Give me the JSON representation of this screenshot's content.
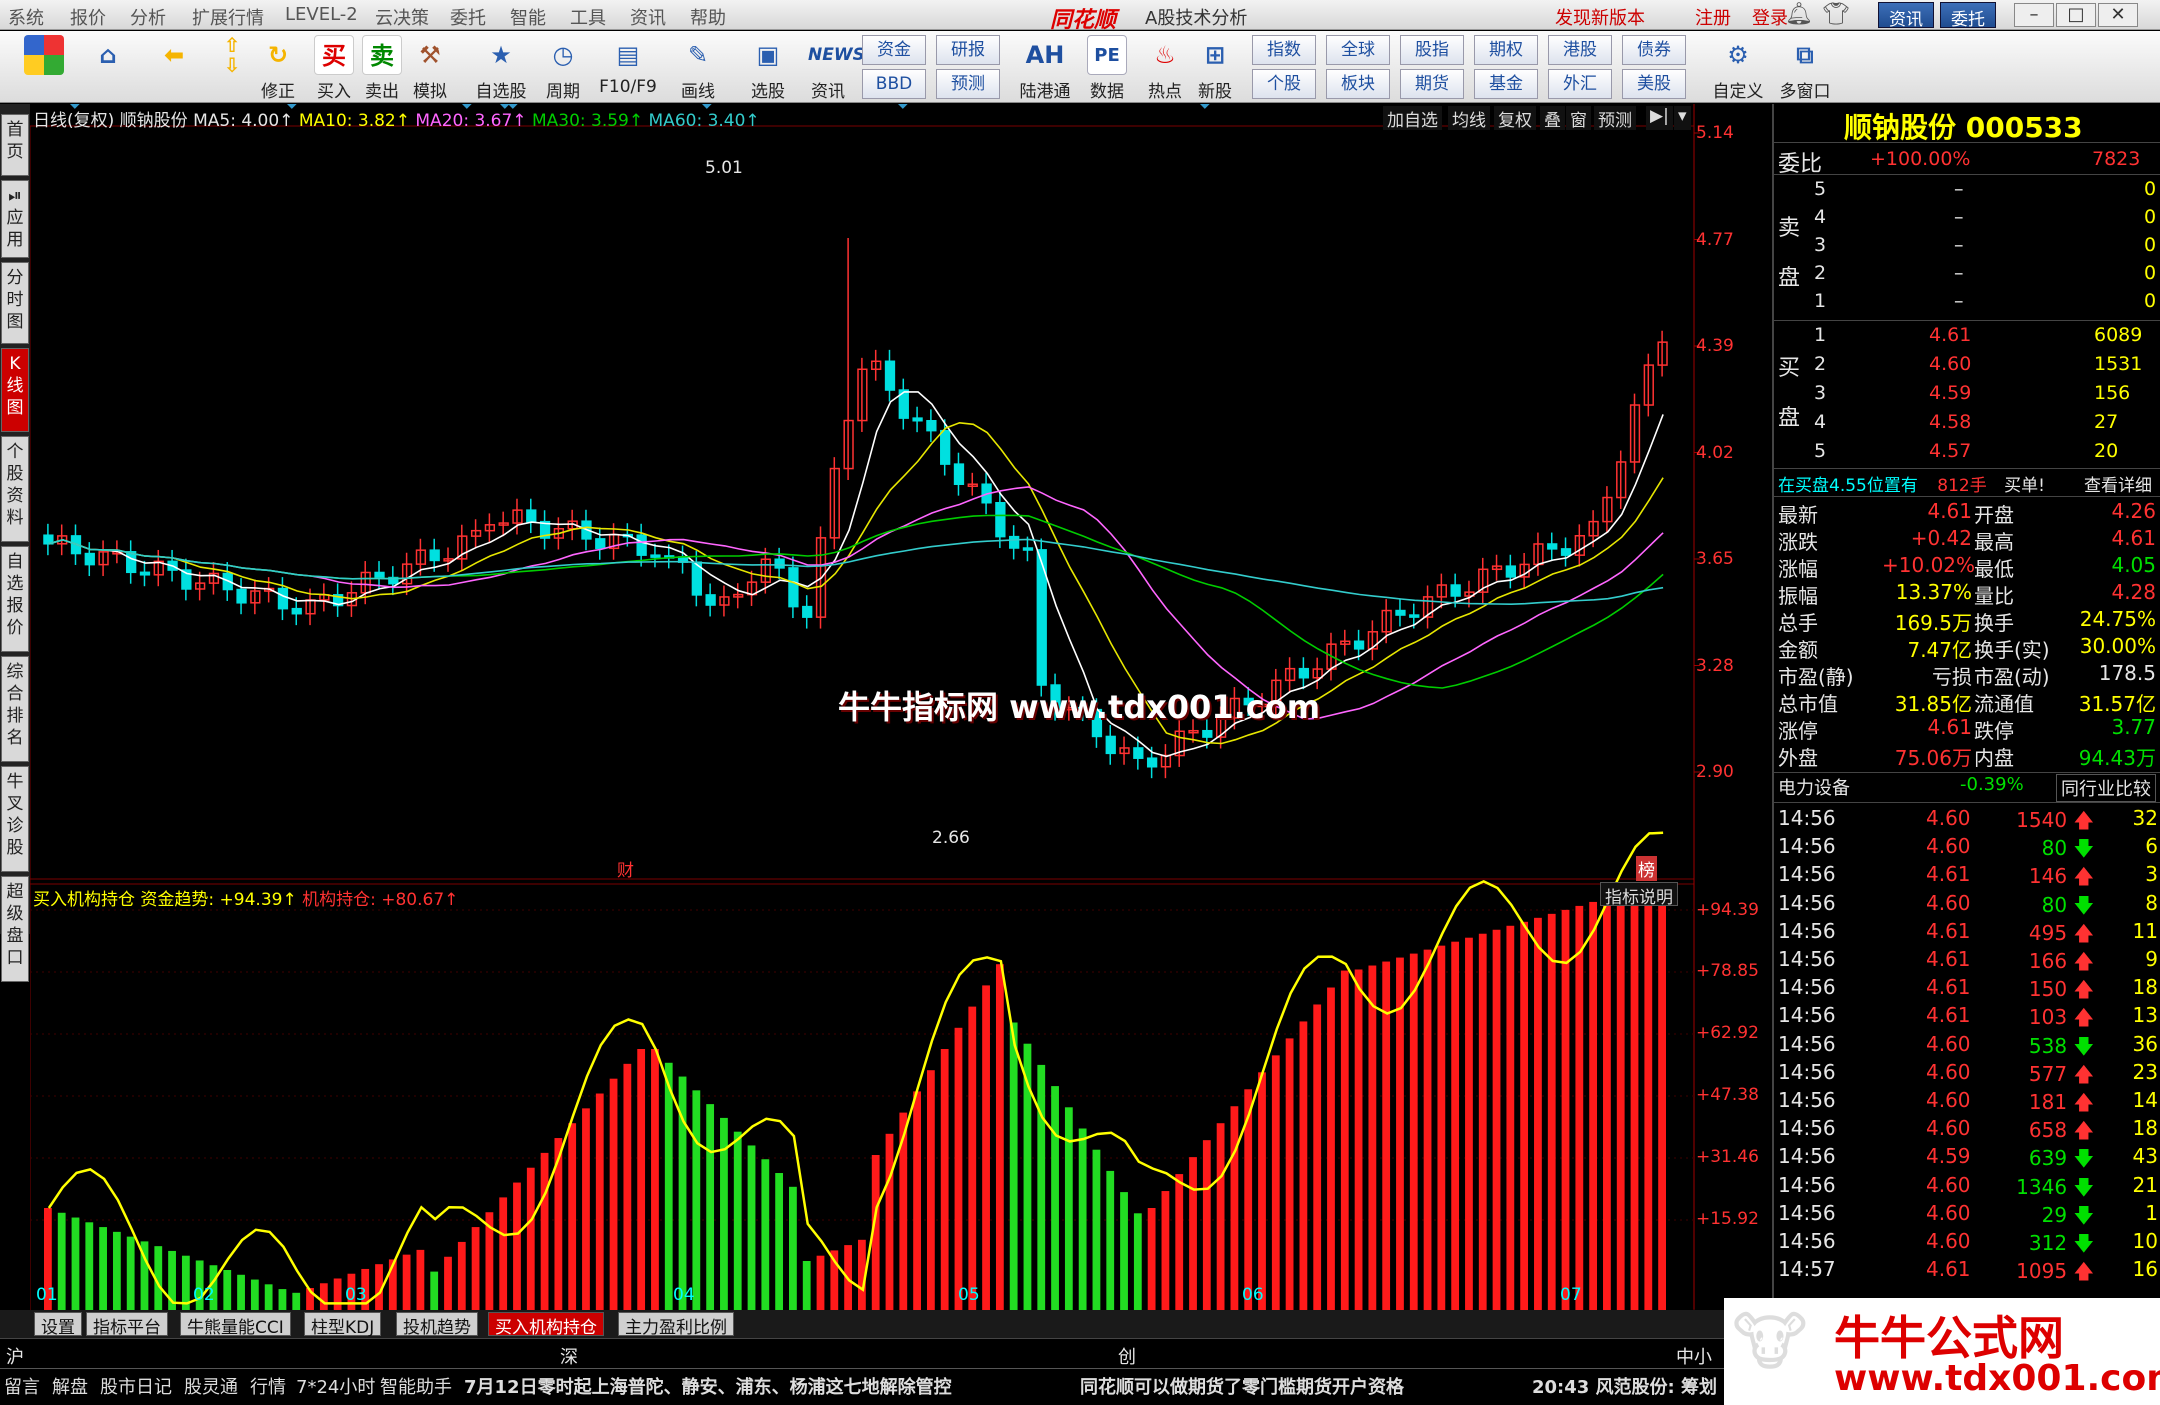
{
  "menu": [
    "系统",
    "报价",
    "分析",
    "扩展行情",
    "LEVEL-2",
    "云决策",
    "委托",
    "智能",
    "工具",
    "资讯",
    "帮助"
  ],
  "app_logo": "同花顺",
  "app_title": "A股技术分析",
  "menu_right": {
    "new_version": "发现新版本",
    "register": "注册",
    "login": "登录",
    "news_btn": "资讯",
    "trade_btn": "委托"
  },
  "toolbar": {
    "buttons": [
      {
        "label": "",
        "icon": "home-icon"
      },
      {
        "label": "",
        "icon": "back-arrow-icon"
      },
      {
        "label": "",
        "icon": "up-down-icon"
      },
      {
        "label": "修正",
        "icon": "refresh-icon"
      },
      {
        "label": "买入",
        "icon": "buy-icon",
        "glyph": "买"
      },
      {
        "label": "卖出",
        "icon": "sell-icon",
        "glyph": "卖"
      },
      {
        "label": "模拟",
        "icon": "hammer-icon"
      },
      {
        "label": "自选股",
        "icon": "star-icon"
      },
      {
        "label": "周期",
        "icon": "clock-icon"
      },
      {
        "label": "F10/F9",
        "icon": "f10-icon"
      },
      {
        "label": "画线",
        "icon": "pen-icon"
      },
      {
        "label": "选股",
        "icon": "filter-icon"
      },
      {
        "label": "资讯",
        "icon": "news-icon",
        "glyph": "NEWS"
      },
      {
        "label": "陆港通",
        "icon": "ah-icon",
        "glyph": "AH"
      },
      {
        "label": "数据",
        "icon": "pe-icon",
        "glyph": "PE"
      },
      {
        "label": "热点",
        "icon": "hot-icon"
      },
      {
        "label": "新股",
        "icon": "newstock-icon"
      },
      {
        "label": "自定义",
        "icon": "custom-icon"
      },
      {
        "label": "多窗口",
        "icon": "multiwindow-icon"
      }
    ],
    "small": [
      "资金",
      "研报",
      "BBD",
      "预测",
      "指数",
      "全球",
      "股指",
      "期权",
      "港股",
      "债券",
      "个股",
      "板块",
      "期货",
      "基金",
      "外汇",
      "美股"
    ]
  },
  "left_tabs": [
    "首页",
    "应用",
    "分时图",
    "K线图",
    "个股资料",
    "自选报价",
    "综合排名",
    "牛叉诊股",
    "超级盘口"
  ],
  "main_header": {
    "period": "日线(复权)",
    "stock": "顺钠股份",
    "ma5": "MA5: 4.00↑",
    "ma10": "MA10: 3.82↑",
    "ma20": "MA20: 3.67↑",
    "ma30": "MA30: 3.59↑",
    "ma60": "MA60: 3.40↑"
  },
  "chart_buttons": [
    "加自选",
    "均线",
    "复权",
    "叠",
    "窗",
    "预测"
  ],
  "price_axis": [
    "5.14",
    "4.77",
    "4.39",
    "4.02",
    "3.65",
    "3.28",
    "2.90"
  ],
  "annotations": {
    "high": "5.01",
    "low": "2.66",
    "cai": "财",
    "bang": "榜"
  },
  "sub_header": {
    "name": "买入机构持仓",
    "trend": "资金趋势: +94.39↑",
    "hold": "机构持仓: +80.67↑",
    "explain": "指标说明"
  },
  "sub_axis": [
    "+94.39",
    "+78.85",
    "+62.92",
    "+47.38",
    "+31.46",
    "+15.92"
  ],
  "x_axis": [
    "01",
    "02",
    "03",
    "04",
    "05",
    "06",
    "07"
  ],
  "bottom_tabs": [
    "设置",
    "指标平台",
    "牛熊量能CCI",
    "柱型KDJ",
    "投机趋势",
    "买入机构持仓",
    "主力盈利比例"
  ],
  "index_bar": {
    "sh": "沪",
    "sz": "深",
    "cy": "创",
    "zx": "中小"
  },
  "status_bar": {
    "buttons": [
      "留言",
      "解盘",
      "股市日记",
      "股灵通",
      "行情",
      "7*24小时",
      "智能助手"
    ],
    "ticker1": "7月12日零时起上海普陀、静安、浦东、杨浦这七地解除管控",
    "ticker2": "同花顺可以做期货了零门槛期货开户资格",
    "ticker3": "20:43 风范股份: 筹划"
  },
  "watermark": {
    "center": "牛牛指标网 www.tdx001.com",
    "corner_title": "牛牛公式网",
    "corner_url": "www.tdx001.com"
  },
  "quote": {
    "title": "顺钠股份 000533",
    "weibi_label": "委比",
    "weibi": "+100.00%",
    "weicha": "7823",
    "sell_label": "卖盘",
    "buy_label": "买盘",
    "sell": [
      {
        "lvl": "5",
        "price": "–",
        "vol": "0"
      },
      {
        "lvl": "4",
        "price": "–",
        "vol": "0"
      },
      {
        "lvl": "3",
        "price": "–",
        "vol": "0"
      },
      {
        "lvl": "2",
        "price": "–",
        "vol": "0"
      },
      {
        "lvl": "1",
        "price": "–",
        "vol": "0"
      }
    ],
    "buy": [
      {
        "lvl": "1",
        "price": "4.61",
        "vol": "6089"
      },
      {
        "lvl": "2",
        "price": "4.60",
        "vol": "1531"
      },
      {
        "lvl": "3",
        "price": "4.59",
        "vol": "156"
      },
      {
        "lvl": "4",
        "price": "4.58",
        "vol": "27"
      },
      {
        "lvl": "5",
        "price": "4.57",
        "vol": "20"
      }
    ],
    "buy_notice": {
      "text": "在买盘4.55位置有",
      "vol": "812手",
      "tail": "买单!",
      "detail": "查看详细"
    },
    "stats": [
      {
        "l1": "最新",
        "v1": "4.61",
        "c1": "red",
        "l2": "开盘",
        "v2": "4.26",
        "c2": "red"
      },
      {
        "l1": "涨跌",
        "v1": "+0.42",
        "c1": "red",
        "l2": "最高",
        "v2": "4.61",
        "c2": "red"
      },
      {
        "l1": "涨幅",
        "v1": "+10.02%",
        "c1": "red",
        "l2": "最低",
        "v2": "4.05",
        "c2": "green"
      },
      {
        "l1": "振幅",
        "v1": "13.37%",
        "c1": "yellow",
        "l2": "量比",
        "v2": "4.28",
        "c2": "red"
      },
      {
        "l1": "总手",
        "v1": "169.5万",
        "c1": "yellow",
        "l2": "换手",
        "v2": "24.75%",
        "c2": "yellow"
      },
      {
        "l1": "金额",
        "v1": "7.47亿",
        "c1": "yellow",
        "l2": "换手(实)",
        "v2": "30.00%",
        "c2": "yellow"
      },
      {
        "l1": "市盈(静)",
        "v1": "亏损",
        "c1": "white",
        "l2": "市盈(动)",
        "v2": "178.5",
        "c2": "white"
      },
      {
        "l1": "总市值",
        "v1": "31.85亿",
        "c1": "yellow",
        "l2": "流通值",
        "v2": "31.57亿",
        "c2": "yellow"
      },
      {
        "l1": "涨停",
        "v1": "4.61",
        "c1": "red",
        "l2": "跌停",
        "v2": "3.77",
        "c2": "green"
      },
      {
        "l1": "外盘",
        "v1": "75.06万",
        "c1": "red",
        "l2": "内盘",
        "v2": "94.43万",
        "c2": "green"
      }
    ],
    "sector": {
      "name": "电力设备",
      "change": "-0.39%",
      "compare": "同行业比较"
    },
    "ticks": [
      {
        "t": "14:56",
        "p": "4.60",
        "v": "1540",
        "d": "up",
        "n": "32"
      },
      {
        "t": "14:56",
        "p": "4.60",
        "v": "80",
        "d": "down",
        "n": "6"
      },
      {
        "t": "14:56",
        "p": "4.61",
        "v": "146",
        "d": "up",
        "n": "3"
      },
      {
        "t": "14:56",
        "p": "4.60",
        "v": "80",
        "d": "down",
        "n": "8"
      },
      {
        "t": "14:56",
        "p": "4.61",
        "v": "495",
        "d": "up",
        "n": "11"
      },
      {
        "t": "14:56",
        "p": "4.61",
        "v": "166",
        "d": "up",
        "n": "9"
      },
      {
        "t": "14:56",
        "p": "4.61",
        "v": "150",
        "d": "up",
        "n": "18"
      },
      {
        "t": "14:56",
        "p": "4.61",
        "v": "103",
        "d": "up",
        "n": "13"
      },
      {
        "t": "14:56",
        "p": "4.60",
        "v": "538",
        "d": "down",
        "n": "36"
      },
      {
        "t": "14:56",
        "p": "4.60",
        "v": "577",
        "d": "up",
        "n": "23"
      },
      {
        "t": "14:56",
        "p": "4.60",
        "v": "181",
        "d": "up",
        "n": "14"
      },
      {
        "t": "14:56",
        "p": "4.60",
        "v": "658",
        "d": "up",
        "n": "18"
      },
      {
        "t": "14:56",
        "p": "4.59",
        "v": "639",
        "d": "down",
        "n": "43"
      },
      {
        "t": "14:56",
        "p": "4.60",
        "v": "1346",
        "d": "down",
        "n": "21"
      },
      {
        "t": "14:56",
        "p": "4.60",
        "v": "29",
        "d": "down",
        "n": "1"
      },
      {
        "t": "14:56",
        "p": "4.60",
        "v": "312",
        "d": "down",
        "n": "10"
      },
      {
        "t": "14:57",
        "p": "4.61",
        "v": "1095",
        "d": "up",
        "n": "16"
      }
    ]
  },
  "colors": {
    "up": "#ff3232",
    "down": "#00e0e0",
    "ma5": "#ffffff",
    "ma10": "#e6e600",
    "ma20": "#ff66ff",
    "ma30": "#00cc00",
    "ma60": "#33cccc"
  }
}
